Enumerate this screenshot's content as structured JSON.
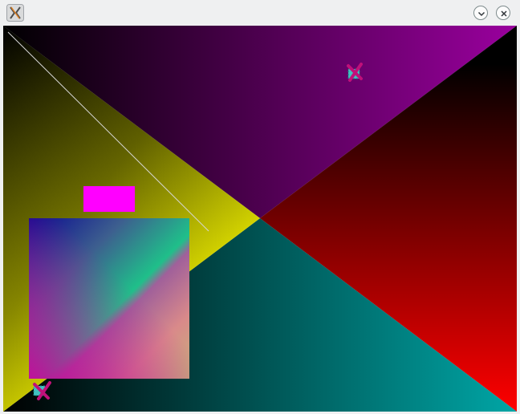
{
  "window": {
    "title": "",
    "app_icon": "x-application-icon",
    "buttons": [
      {
        "name": "minimize",
        "icon": "chevron-down-icon"
      },
      {
        "name": "close",
        "icon": "close-icon"
      }
    ]
  },
  "canvas": {
    "background": "#000000",
    "quadrant_colors": {
      "top": "#9a00a0",
      "right": "#ee0000",
      "bottom": "#009a9a",
      "left": "#eeee00"
    },
    "rectangle_color": "#ff00ff",
    "marker_colors": {
      "stroke": "#c0107a",
      "fill": "#40c0c0"
    }
  }
}
